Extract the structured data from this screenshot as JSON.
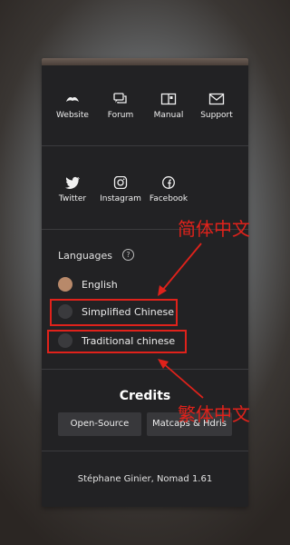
{
  "links_row1": [
    {
      "label": "Website",
      "icon": "website-icon"
    },
    {
      "label": "Forum",
      "icon": "forum-icon"
    },
    {
      "label": "Manual",
      "icon": "manual-icon"
    },
    {
      "label": "Support",
      "icon": "support-icon"
    }
  ],
  "links_row2": [
    {
      "label": "Twitter",
      "icon": "twitter-icon"
    },
    {
      "label": "Instagram",
      "icon": "instagram-icon"
    },
    {
      "label": "Facebook",
      "icon": "facebook-icon"
    }
  ],
  "languages": {
    "title": "Languages",
    "help": "?",
    "options": [
      {
        "label": "English",
        "selected": true
      },
      {
        "label": "Simplified Chinese",
        "selected": false
      },
      {
        "label": "Traditional chinese",
        "selected": false
      }
    ]
  },
  "credits": {
    "title": "Credits",
    "buttons": [
      "Open-Source",
      "Matcaps & Hdris"
    ]
  },
  "footer": "Stéphane Ginier, Nomad 1.61",
  "annotations": {
    "simplified": "简体中文",
    "traditional": "繁体中文"
  },
  "colors": {
    "accent": "#b8896a",
    "annotation": "#e0221b",
    "panel": "#222224"
  }
}
